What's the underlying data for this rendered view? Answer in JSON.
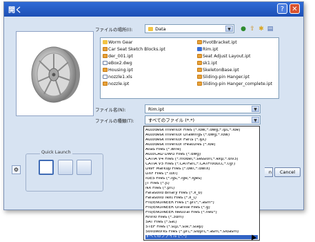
{
  "window": {
    "title": "開く",
    "help_glyph": "?",
    "close_glyph": "✕"
  },
  "location": {
    "label": "ファイルの場所(I):",
    "value": "Data"
  },
  "files": {
    "column1": [
      {
        "name": "Worm Gear",
        "icon": "folder-icon"
      },
      {
        "name": "Car Seat Sketch Blocks.ipt",
        "icon": "ipt-file-icon"
      },
      {
        "name": "der_001.ipt",
        "icon": "ipt-file-icon"
      },
      {
        "name": "eBox2.dwg",
        "icon": "dwg-file-icon"
      },
      {
        "name": "Housing.ipt",
        "icon": "ipt-file-icon"
      },
      {
        "name": "nozzle1.xls",
        "icon": "doc-file-icon"
      },
      {
        "name": "nozzle.ipt",
        "icon": "ipt-file-icon"
      }
    ],
    "column2": [
      {
        "name": "PivotBracket.ipt",
        "icon": "ipt-file-icon"
      },
      {
        "name": "Rim.ipt",
        "icon": "ipt-file-icon",
        "selected": true
      },
      {
        "name": "Seat Adjust Layout.ipt",
        "icon": "ipt-file-icon"
      },
      {
        "name": "sk1.ipt",
        "icon": "ipt-file-icon"
      },
      {
        "name": "SkeletonBase.ipt",
        "icon": "ipt-file-icon"
      },
      {
        "name": "Sliding-pin Hanger.ipt",
        "icon": "ipt-file-icon"
      },
      {
        "name": "Sliding-pin Hanger_complete.ipt",
        "icon": "ipt-file-icon"
      }
    ]
  },
  "filename": {
    "label": "ファイル名(N):",
    "value": "Rim.ipt"
  },
  "filetype": {
    "label": "ファイルの種類(T):",
    "value": "すべてのファイル (*.*)",
    "options": [
      "Autodesk Inventor Files (*.idw;*.dwg;*.ipt;*.ide)",
      "Autodesk Inventor Drawings (*.dwg;*.idw)",
      "Autodesk Inventor Parts (*.ipt)",
      "Autodesk Inventor iFeatures (*.ide)",
      "Alias Files (*.wire)",
      "AutoCAD DWG Files (*.dwg)",
      "CATIA V4 Files (*.model;*.session;*.exp;*.dlv3)",
      "CATIA V5 Files (*.CATPart;*.CATProduct;*.cgr)",
      "DWF Markup Files (*.dwf;*.dwfx)",
      "DXF Files (*.dxf)",
      "IGES Files (*.igs;*.ige;*.iges)",
      "JT Files (*.jt)",
      "NX Files (*.prt)",
      "Parasolid Binary Files (*.x_b)",
      "Parasolid Text Files (*.x_t)",
      "Pro/ENGINEER Files (*.prt*;*.asm*)",
      "Pro/ENGINEER Granite Files (*.g)",
      "Pro/ENGINEER Neutral Files (*.neu*)",
      "Rhino Files (*.3dm)",
      "SAT Files (*.sat)",
      "STEP Files (*.stp;*.ste;*.step)",
      "SolidWorks Files (*.prt;*.sldprt;*.asm;*.sldasm)",
      "すべてのファイル (*.*)"
    ],
    "selected_index": 22
  },
  "quick_launch": {
    "label": "Quick Launch"
  },
  "buttons": {
    "cancel": "Cancel",
    "open_stub": "n"
  }
}
